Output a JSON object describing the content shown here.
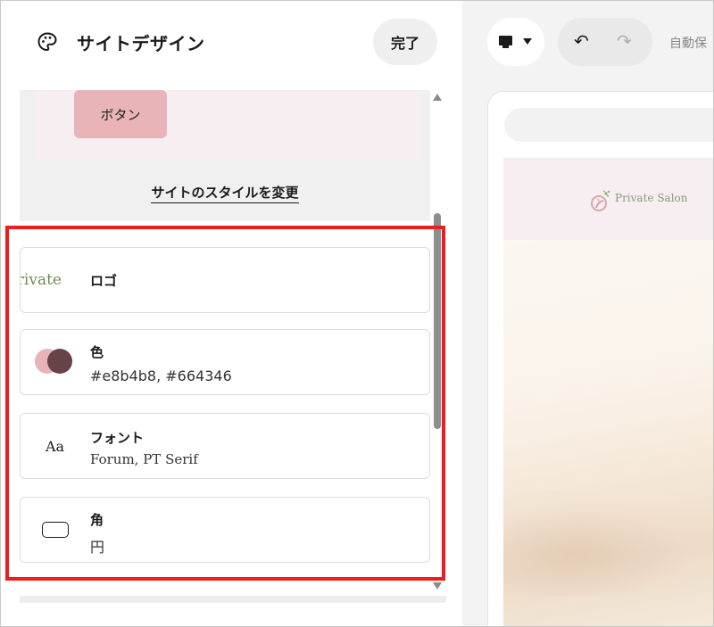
{
  "panel": {
    "title": "サイトデザイン",
    "done_label": "完了",
    "style_preview": {
      "button_label": "ボタン",
      "change_style_label": "サイトのスタイルを変更"
    },
    "items": [
      {
        "title": "ロゴ",
        "icon": "logo-preview-icon",
        "logo_text": "Private"
      },
      {
        "title": "色",
        "subtitle": "#e8b4b8, #664346",
        "icon": "color-swatch-icon",
        "colors": [
          "#e8b4b8",
          "#664346"
        ]
      },
      {
        "title": "フォント",
        "subtitle": "Forum, PT Serif",
        "icon": "font-icon",
        "glyph": "Aa"
      },
      {
        "title": "角",
        "subtitle": "円",
        "icon": "corner-radius-icon"
      }
    ]
  },
  "toolbar": {
    "device_icon": "desktop-icon",
    "autosave_label": "自動保"
  },
  "site_preview": {
    "brand_name": "Private Salon"
  },
  "colors": {
    "accent": "#e8b4b8",
    "secondary": "#664346",
    "highlight": "#ee1c1c"
  }
}
